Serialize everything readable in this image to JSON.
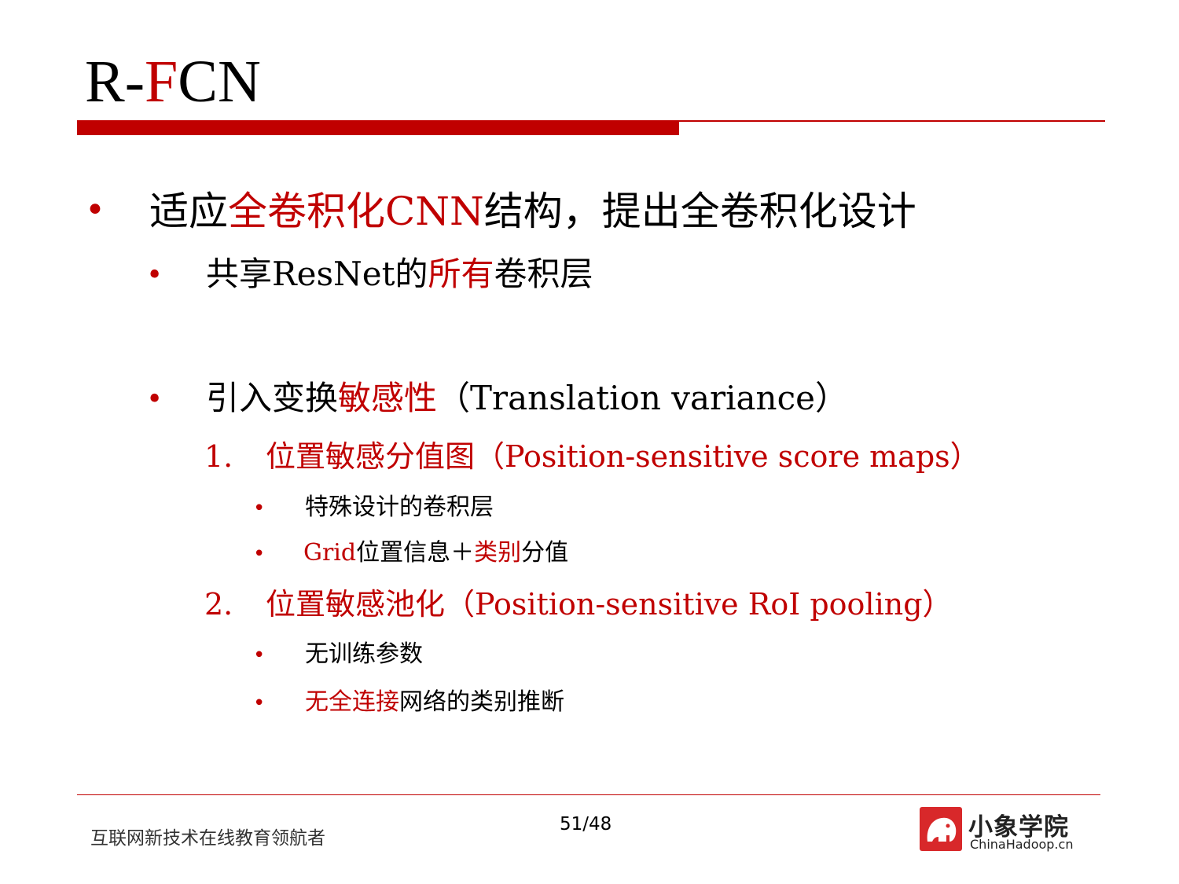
{
  "title": {
    "part1": "R-",
    "part2": "F",
    "part3": "CN"
  },
  "bullets": {
    "b1": {
      "pre": "适应",
      "red": "全卷积化CNN",
      "post": "结构，提出全卷积化设计"
    },
    "b1_1": {
      "pre": "共享ResNet的",
      "red": "所有",
      "post": "卷积层"
    },
    "b1_2": {
      "pre": "引入变换",
      "red": "敏感性",
      "post": "（Translation variance）"
    },
    "n1": {
      "num": "1.",
      "text": "位置敏感分值图（Position-sensitive score maps）"
    },
    "n1_a": {
      "text": "特殊设计的卷积层"
    },
    "n1_b": {
      "red1": "Grid",
      "mid": "位置信息＋",
      "red2": "类别",
      "post": "分值"
    },
    "n2": {
      "num": "2.",
      "text": "位置敏感池化（Position-sensitive RoI pooling）"
    },
    "n2_a": {
      "text": "无训练参数"
    },
    "n2_b": {
      "red": "无全连接",
      "post": "网络的类别推断"
    }
  },
  "footer": {
    "tagline": "互联网新技术在线教育领航者",
    "page": "51/48",
    "logo_cn": "小象学院",
    "logo_en": "ChinaHadoop.cn"
  },
  "colors": {
    "accent": "#c00000",
    "logo_red": "#d8282a"
  }
}
